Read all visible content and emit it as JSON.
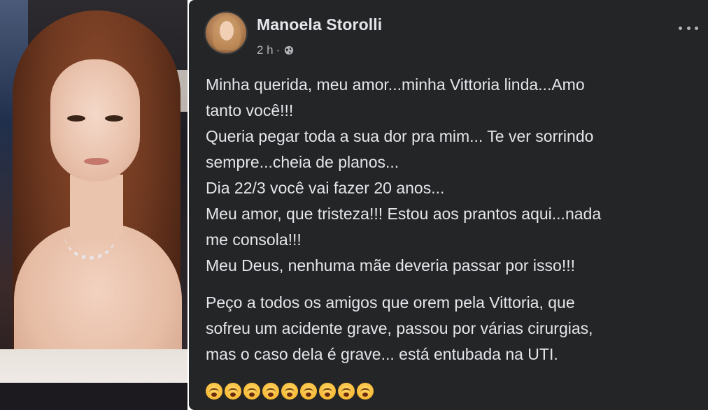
{
  "post": {
    "author": "Manoela Storolli",
    "time": "2 h",
    "separator": "·",
    "privacy_icon": "globe-icon",
    "menu_icon": "more-options-icon",
    "paragraph1": [
      "Minha querida, meu amor...minha Vittoria linda...Amo",
      "tanto você!!!",
      "Queria pegar toda a sua dor pra mim... Te ver sorrindo",
      "sempre...cheia de planos...",
      "Dia 22/3 você vai fazer 20 anos...",
      "Meu amor, que tristeza!!! Estou aos prantos aqui...nada",
      "me consola!!!",
      "Meu Deus, nenhuma mãe deveria passar por isso!!!"
    ],
    "paragraph2": [
      "Peço a todos os amigos que orem pela Vittoria, que",
      "sofreu um acidente grave, passou por várias cirurgias,",
      "mas o caso dela é grave... está entubada na UTI."
    ],
    "emoji_icon": "crying-face-icon",
    "emoji_count": 9
  },
  "colors": {
    "post_background": "#242526",
    "primary_text": "#e4e6eb",
    "secondary_text": "#b0b3b8"
  }
}
